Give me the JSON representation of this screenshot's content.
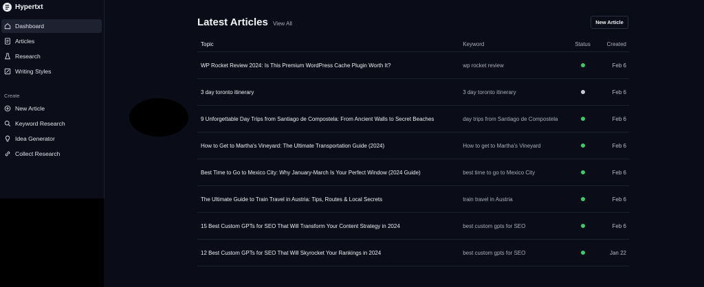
{
  "app": {
    "name": "Hypertxt"
  },
  "sidebar": {
    "items": [
      {
        "label": "Dashboard",
        "icon": "home-icon",
        "active": true
      },
      {
        "label": "Articles",
        "icon": "document-icon"
      },
      {
        "label": "Research",
        "icon": "flask-icon"
      },
      {
        "label": "Writing Styles",
        "icon": "edit-icon"
      }
    ],
    "section_label": "Create",
    "create_items": [
      {
        "label": "New Article",
        "icon": "plus-circle-icon"
      },
      {
        "label": "Keyword Research",
        "icon": "search-icon"
      },
      {
        "label": "Idea Generator",
        "icon": "lightbulb-icon"
      },
      {
        "label": "Collect Research",
        "icon": "link-icon"
      }
    ]
  },
  "main": {
    "title": "Latest Articles",
    "view_all": "View All",
    "new_article_button": "New Article",
    "columns": {
      "topic": "Topic",
      "keyword": "Keyword",
      "status": "Status",
      "created": "Created"
    },
    "rows": [
      {
        "topic": "WP Rocket Review 2024: Is This Premium WordPress Cache Plugin Worth It?",
        "keyword": "wp rocket review",
        "status": "published",
        "created": "Feb 6"
      },
      {
        "topic": "3 day toronto itinerary",
        "keyword": "3 day toronto itinerary",
        "status": "draft",
        "created": "Feb 6"
      },
      {
        "topic": "9 Unforgettable Day Trips from Santiago de Compostela: From Ancient Walls to Secret Beaches",
        "keyword": "day trips from Santiago de Compostela",
        "status": "published",
        "created": "Feb 6"
      },
      {
        "topic": "How to Get to Martha's Vineyard: The Ultimate Transportation Guide (2024)",
        "keyword": "How to get to Martha's Vineyard",
        "status": "published",
        "created": "Feb 6"
      },
      {
        "topic": "Best Time to Go to Mexico City: Why January-March Is Your Perfect Window (2024 Guide)",
        "keyword": "best time to go to Mexico City",
        "status": "published",
        "created": "Feb 6"
      },
      {
        "topic": "The Ultimate Guide to Train Travel in Austria: Tips, Routes & Local Secrets",
        "keyword": "train travel in Austria",
        "status": "published",
        "created": "Feb 6"
      },
      {
        "topic": "15 Best Custom GPTs for SEO That Will Transform Your Content Strategy in 2024",
        "keyword": "best custom gpts for SEO",
        "status": "published",
        "created": "Feb 6"
      },
      {
        "topic": "12 Best Custom GPTs for SEO That Will Skyrocket Your Rankings in 2024",
        "keyword": "best custom gpts for SEO",
        "status": "published",
        "created": "Jan 22"
      }
    ]
  },
  "colors": {
    "status_published": "#3ec96b",
    "status_draft": "#c7cad3",
    "background": "#0a0d17"
  }
}
